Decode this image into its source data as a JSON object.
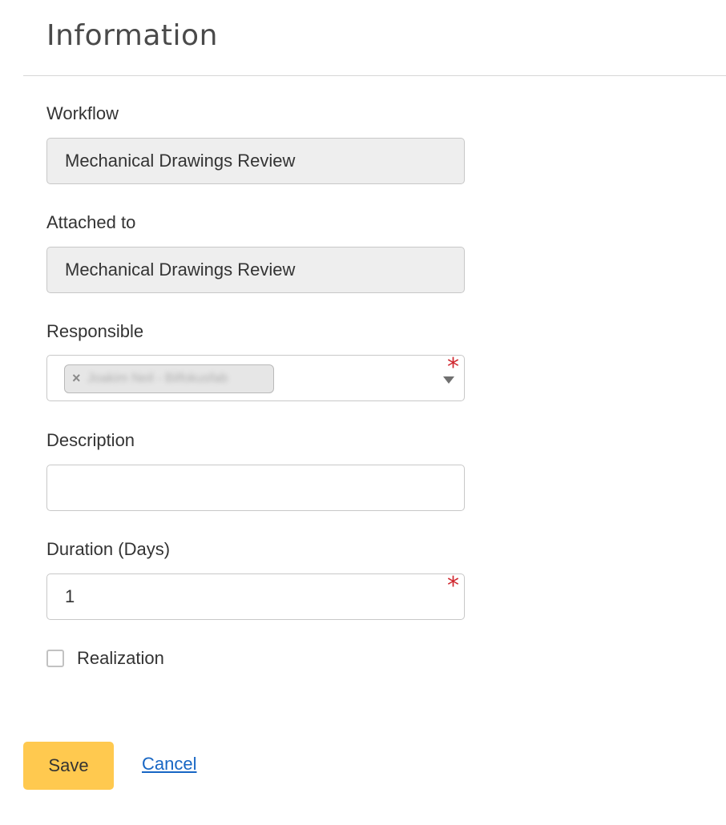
{
  "header": {
    "title": "Information"
  },
  "form": {
    "workflow": {
      "label": "Workflow",
      "value": "Mechanical Drawings Review"
    },
    "attached_to": {
      "label": "Attached to",
      "value": "Mechanical Drawings Review"
    },
    "responsible": {
      "label": "Responsible",
      "chip_remove": "×",
      "chip_text": "Joakim Neil - Bilfokusfab",
      "required_mark": "*"
    },
    "description": {
      "label": "Description",
      "value": ""
    },
    "duration": {
      "label": "Duration (Days)",
      "value": "1",
      "required_mark": "*"
    },
    "realization": {
      "label": "Realization",
      "checked": false
    }
  },
  "actions": {
    "save_label": "Save",
    "cancel_label": "Cancel"
  },
  "colors": {
    "save_button": "#ffc94f",
    "required": "#d0282f",
    "link": "#1766c4",
    "readonly_bg": "#eeeeee"
  }
}
